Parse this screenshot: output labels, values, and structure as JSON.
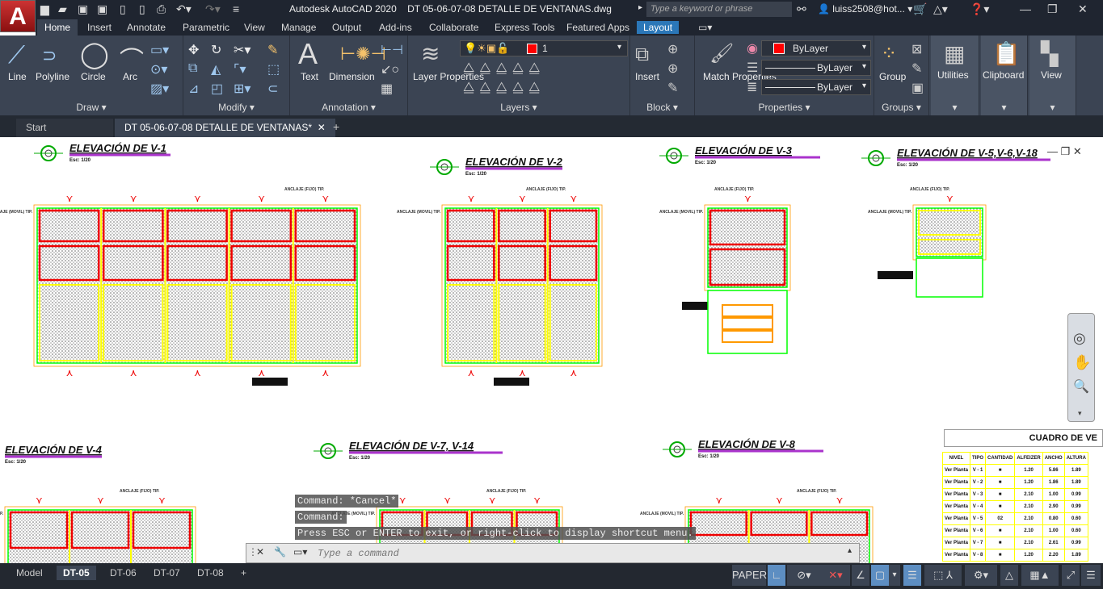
{
  "app": {
    "title": "Autodesk AutoCAD 2020",
    "document": "DT 05-06-07-08 DETALLE DE VENTANAS.dwg",
    "search_placeholder": "Type a keyword or phrase",
    "user": "luiss2508@hot...",
    "logo": "A"
  },
  "ribbon_tabs": [
    "Home",
    "Insert",
    "Annotate",
    "Parametric",
    "View",
    "Manage",
    "Output",
    "Add-ins",
    "Collaborate",
    "Express Tools",
    "Featured Apps",
    "Layout"
  ],
  "panels": {
    "draw": {
      "title": "Draw",
      "buttons": [
        "Line",
        "Polyline",
        "Circle",
        "Arc"
      ]
    },
    "modify": {
      "title": "Modify"
    },
    "annotation": {
      "title": "Annotation",
      "buttons": [
        "Text",
        "Dimension"
      ]
    },
    "layers": {
      "title": "Layers",
      "button": "Layer Properties",
      "current_layer": "1",
      "layer_color": "#ff0000"
    },
    "block": {
      "title": "Block",
      "button": "Insert"
    },
    "properties": {
      "title": "Properties",
      "button": "Match Properties",
      "color": "ByLayer",
      "linetype": "ByLayer",
      "lineweight": "ByLayer"
    },
    "groups": {
      "title": "Groups",
      "button": "Group"
    },
    "utilities": {
      "button": "Utilities"
    },
    "clipboard": {
      "button": "Clipboard"
    },
    "view": {
      "button": "View"
    }
  },
  "doc_tabs": [
    "Start",
    "DT 05-06-07-08 DETALLE DE VENTANAS*"
  ],
  "drawing": {
    "titles": [
      "ELEVACIÓN DE V-1",
      "ELEVACIÓN DE V-2",
      "ELEVACIÓN DE V-3",
      "ELEVACIÓN DE V-5,V-6,V-18",
      "ELEVACIÓN DE V-4",
      "ELEVACIÓN DE V-7, V-14",
      "ELEVACIÓN DE V-8"
    ],
    "scale": "Esc: 1/20",
    "label_fixed": "ANCLAJE (FIJO) TIP.",
    "label_mobile": "ANCLAJE (MOVIL) TIP.",
    "table": {
      "title": "CUADRO DE VE",
      "headers": [
        "NIVEL",
        "TIPO",
        "CANTIDAD",
        "ALFEIZER",
        "ANCHO",
        "ALTURA"
      ],
      "rows": [
        [
          "Ver Planta",
          "V - 1",
          "■",
          "1.20",
          "5.86",
          "1.89"
        ],
        [
          "Ver Planta",
          "V - 2",
          "■",
          "1.20",
          "1.86",
          "1.89"
        ],
        [
          "Ver Planta",
          "V - 3",
          "■",
          "2.10",
          "1.00",
          "0.99"
        ],
        [
          "Ver Planta",
          "V - 4",
          "■",
          "2.10",
          "2.90",
          "0.99"
        ],
        [
          "Ver Planta",
          "V - 5",
          "02",
          "2.10",
          "0.80",
          "0.60"
        ],
        [
          "Ver Planta",
          "V - 6",
          "■",
          "2.10",
          "1.00",
          "0.60"
        ],
        [
          "Ver Planta",
          "V - 7",
          "■",
          "2.10",
          "2.61",
          "0.99"
        ],
        [
          "Ver Planta",
          "V - 8",
          "■",
          "1.20",
          "2.20",
          "1.89"
        ]
      ]
    }
  },
  "command": {
    "history": [
      "Command: *Cancel*",
      "Command:",
      "Press ESC or ENTER to exit, or right-click to display shortcut menu."
    ],
    "placeholder": "Type a command"
  },
  "layout_tabs": [
    "Model",
    "DT-05",
    "DT-06",
    "DT-07",
    "DT-08"
  ],
  "status": {
    "space": "PAPER"
  }
}
